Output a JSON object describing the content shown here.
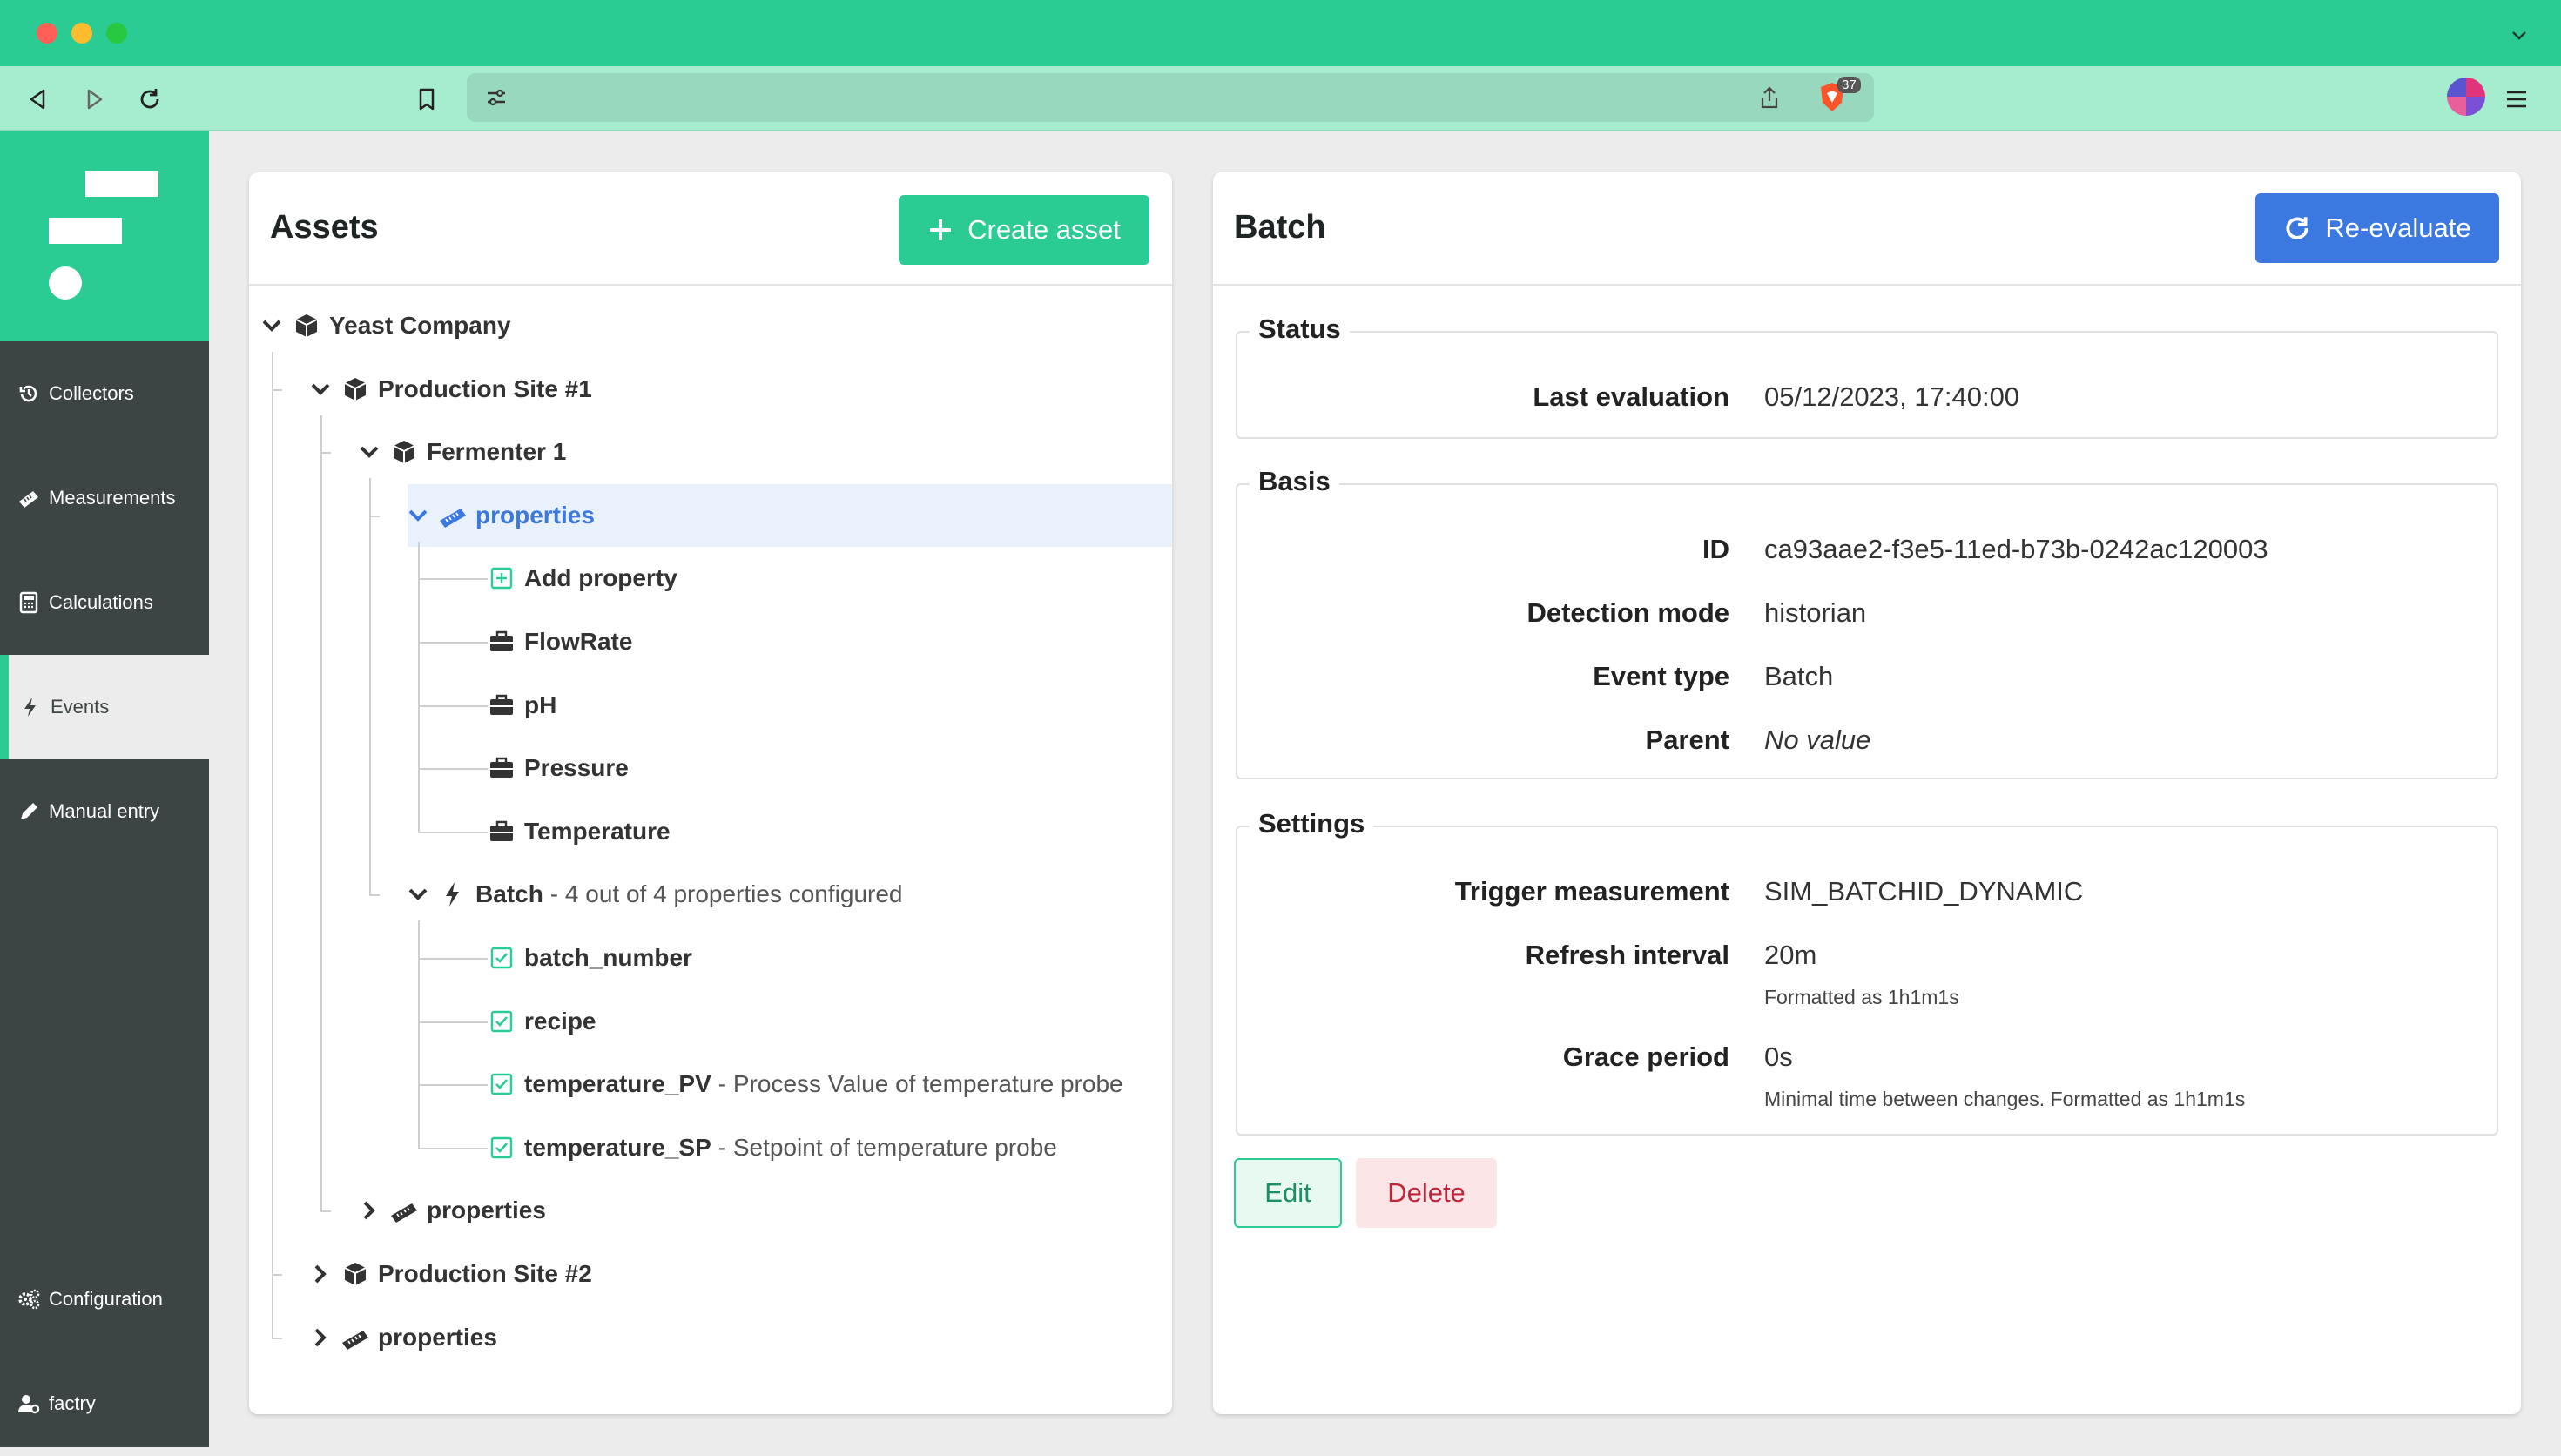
{
  "sidebar": {
    "items": [
      {
        "label": "Collectors",
        "icon": "history-icon"
      },
      {
        "label": "Measurements",
        "icon": "ruler-icon"
      },
      {
        "label": "Calculations",
        "icon": "calculator-icon"
      },
      {
        "label": "Events",
        "icon": "bolt-icon",
        "active": true
      },
      {
        "label": "Manual entry",
        "icon": "pen-icon"
      }
    ],
    "bottom": [
      {
        "label": "Configuration",
        "icon": "gears-icon"
      },
      {
        "label": "factry",
        "icon": "user-gear-icon"
      }
    ]
  },
  "browser": {
    "shield_count": "37"
  },
  "assets": {
    "title": "Assets",
    "create_label": "Create asset",
    "tree": [
      {
        "name": "Yeast Company",
        "icon": "cube-icon",
        "expanded": true
      },
      {
        "name": "Production Site #1",
        "icon": "cube-icon",
        "expanded": true
      },
      {
        "name": "Fermenter 1",
        "icon": "cube-icon",
        "expanded": true
      },
      {
        "name": "properties",
        "icon": "ruler-icon",
        "expanded": true,
        "selected": true
      },
      {
        "name": "Add property",
        "icon": "plus-square-icon"
      },
      {
        "name": "FlowRate",
        "icon": "toolbox-icon"
      },
      {
        "name": "pH",
        "icon": "toolbox-icon"
      },
      {
        "name": "Pressure",
        "icon": "toolbox-icon"
      },
      {
        "name": "Temperature",
        "icon": "toolbox-icon"
      },
      {
        "name": "Batch",
        "desc": "- 4 out of 4 properties configured",
        "icon": "bolt-icon",
        "expanded": true
      },
      {
        "name": "batch_number",
        "icon": "check-square-icon"
      },
      {
        "name": "recipe",
        "icon": "check-square-icon"
      },
      {
        "name": "temperature_PV",
        "desc": "- Process Value of temperature probe",
        "icon": "check-square-icon"
      },
      {
        "name": "temperature_SP",
        "desc": "- Setpoint of temperature probe",
        "icon": "check-square-icon"
      },
      {
        "name": "properties",
        "icon": "ruler-icon",
        "expanded": false
      },
      {
        "name": "Production Site #2",
        "icon": "cube-icon",
        "expanded": false
      },
      {
        "name": "properties",
        "icon": "ruler-icon",
        "expanded": false
      }
    ]
  },
  "detail": {
    "title": "Batch",
    "reevaluate_label": "Re-evaluate",
    "status": {
      "legend": "Status",
      "last_evaluation_label": "Last evaluation",
      "last_evaluation_value": "05/12/2023, 17:40:00"
    },
    "basis": {
      "legend": "Basis",
      "id_label": "ID",
      "id_value": "ca93aae2-f3e5-11ed-b73b-0242ac120003",
      "detection_mode_label": "Detection mode",
      "detection_mode_value": "historian",
      "event_type_label": "Event type",
      "event_type_value": "Batch",
      "parent_label": "Parent",
      "parent_value": "No value"
    },
    "settings": {
      "legend": "Settings",
      "trigger_label": "Trigger measurement",
      "trigger_value": "SIM_BATCHID_DYNAMIC",
      "refresh_label": "Refresh interval",
      "refresh_value": "20m",
      "refresh_hint": "Formatted as 1h1m1s",
      "grace_label": "Grace period",
      "grace_value": "0s",
      "grace_hint": "Minimal time between changes. Formatted as 1h1m1s"
    },
    "edit_label": "Edit",
    "delete_label": "Delete"
  },
  "colors": {
    "brand": "#2acc93",
    "sidebar": "#3d4444",
    "primary": "#3b78e0",
    "danger": "#c0263a"
  }
}
